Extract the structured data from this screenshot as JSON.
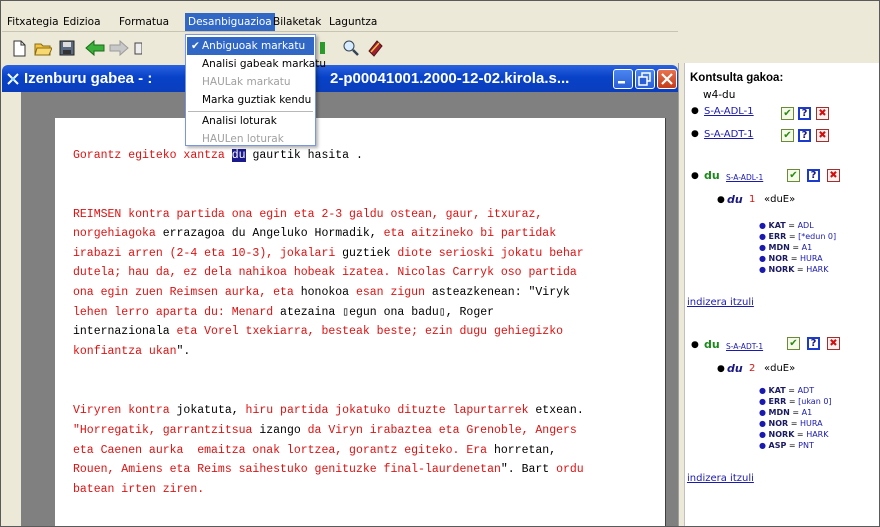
{
  "menubar": {
    "items": [
      {
        "label": "Fitxategia"
      },
      {
        "label": "Edizioa"
      },
      {
        "label": "Formatua"
      },
      {
        "label": "Desanbiguazioa"
      },
      {
        "label": "Bilaketak"
      },
      {
        "label": "Laguntza"
      }
    ]
  },
  "dropdown": {
    "items": [
      {
        "label": "Anbiguoak markatu",
        "checked": "✔"
      },
      {
        "label": "Analisi gabeak markatu"
      },
      {
        "label": "HAULak markatu"
      },
      {
        "label": "Marka guztiak kendu"
      },
      {
        "label": "Analisi loturak"
      },
      {
        "label": "HAULen loturak"
      }
    ]
  },
  "window": {
    "title_left": "Izenburu gabea - :",
    "title_right": "2-p00041001.2000-12-02.kirola.s..."
  },
  "document": {
    "line1": {
      "a": "Gorantz egiteko xantza ",
      "b": "du",
      "c": " gaurtik hasita ."
    },
    "p2": {
      "l1a": "REIMSEN kontra partida ona egin eta 2-3 galdu ostean, gaur, itxuraz,",
      "l2a": "norgehiagoka ",
      "l2b": "errazagoa du Angeluko",
      "l2c": " Hormadik, ",
      "l2d": "eta aitzineko bi partidak",
      "l3a": "irabazi arren (2-4 eta 10-3), jokalari ",
      "l3b": "guztiek",
      "l3c": " diote serioski jokatu behar",
      "l4a": "dutela; hau da, ez dela nahikoa hobeak izatea. Nicolas Carryk oso partida",
      "l5a": "ona egin zuen Reimsen aurka, eta ",
      "l5b": "honokoa",
      "l5c": " esan zigun ",
      "l5d": "asteazkenean: \"Viryk",
      "l6a": "lehen lerro aparta du: Menard ",
      "l6b": "atezaina ▯egun ona badu▯, Roger",
      "l7a": "internazionala ",
      "l7b": "eta Vorel txekiarra, besteak beste; ezin dugu gehiegizko",
      "l8a": "konfiantza ukan",
      "l8b": "\"."
    },
    "p3": {
      "l1a": "Viryren kontra ",
      "l1b": "jokatuta, ",
      "l1c": "hiru partida jokatuko dituzte lapurtarrek ",
      "l1d": "etxean.",
      "l2a": "\"Horregatik, garrantzitsua ",
      "l2b": "izango ",
      "l2c": "da Viryn irabaztea eta Grenoble, Angers",
      "l3a": "eta Caenen aurka  emaitza onak lortzea, gorantz egiteko. Era ",
      "l3b": "horretan,",
      "l4a": "Rouen, Amiens eta Reims saihestuko genituzke final-laurdenetan",
      "l4b": "\". Bart ",
      "l4c": "ordu",
      "l5a": "batean irten ziren."
    }
  },
  "panel": {
    "header": "Kontsulta gakoa:",
    "word": "w4-du",
    "links": [
      "S-A-ADL-1",
      "S-A-ADT-1"
    ],
    "entries": [
      {
        "lemma": "du",
        "analysis": "S-A-ADL-1",
        "form": "du",
        "num": "1",
        "tag": "«duE»",
        "features": [
          {
            "k": "KAT",
            "v": "ADL"
          },
          {
            "k": "ERR",
            "v": "[*edun 0]"
          },
          {
            "k": "MDN",
            "v": "A1"
          },
          {
            "k": "NOR",
            "v": "HURA"
          },
          {
            "k": "NORK",
            "v": "HARK"
          }
        ]
      },
      {
        "lemma": "du",
        "analysis": "S-A-ADT-1",
        "form": "du",
        "num": "2",
        "tag": "«duE»",
        "features": [
          {
            "k": "KAT",
            "v": "ADT"
          },
          {
            "k": "ERR",
            "v": "[ukan 0]"
          },
          {
            "k": "MDN",
            "v": "A1"
          },
          {
            "k": "NOR",
            "v": "HURA"
          },
          {
            "k": "NORK",
            "v": "HARK"
          },
          {
            "k": "ASP",
            "v": "PNT"
          }
        ]
      }
    ],
    "back_link": "indizera itzuli",
    "btn_check": "✔",
    "btn_help": "?",
    "btn_close": "✖"
  },
  "colors": {
    "accent": "#3168c6",
    "text_red": "#e01010",
    "title_blue": "#0842c8"
  }
}
